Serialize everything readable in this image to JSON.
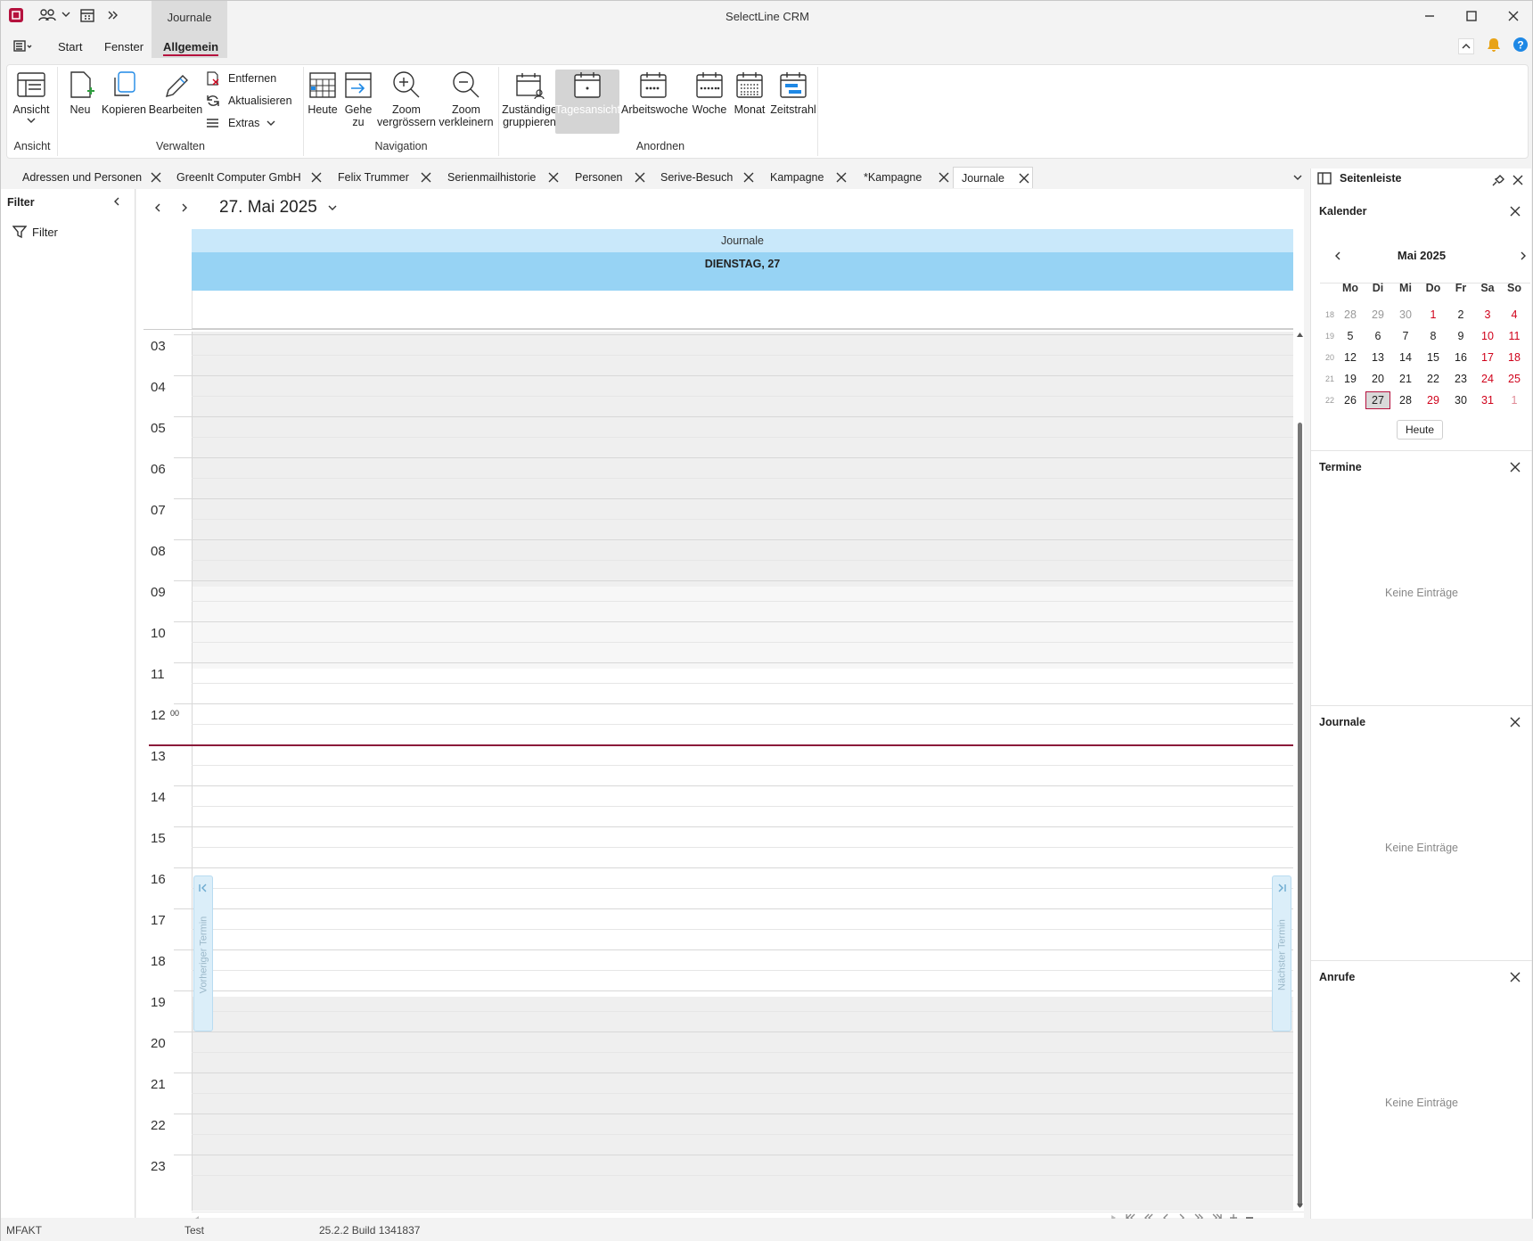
{
  "app": {
    "title": "SelectLine CRM",
    "context_tab": "Journale"
  },
  "menu": {
    "items": [
      "Start",
      "Fenster",
      "Allgemein"
    ],
    "active": "Allgemein"
  },
  "ribbon": {
    "ansicht": {
      "button": "Ansicht",
      "group": "Ansicht"
    },
    "verwalten": {
      "neu": "Neu",
      "kopieren": "Kopieren",
      "bearbeiten": "Bearbeiten",
      "entfernen": "Entfernen",
      "aktualisieren": "Aktualisieren",
      "extras": "Extras",
      "group": "Verwalten"
    },
    "navigation": {
      "heute": "Heute",
      "gehe_zu_1": "Gehe",
      "gehe_zu_2": "zu",
      "zoom_in_1": "Zoom",
      "zoom_in_2": "vergrössern",
      "zoom_out_1": "Zoom",
      "zoom_out_2": "verkleinern",
      "group": "Navigation"
    },
    "anordnen": {
      "zustaendige_1": "Zuständige",
      "zustaendige_2": "gruppieren",
      "tagesansicht": "Tagesansicht",
      "arbeitswoche": "Arbeitswoche",
      "woche": "Woche",
      "monat": "Monat",
      "zeitstrahl": "Zeitstrahl",
      "group": "Anordnen"
    }
  },
  "doc_tabs": [
    "Adressen und Personen",
    "GreenIt Computer GmbH",
    "Felix Trummer",
    "Serienmailhistorie",
    "Personen",
    "Serive-Besuch",
    "Kampagne",
    "*Kampagne",
    "Journale"
  ],
  "filter_panel": {
    "title": "Filter",
    "item": "Filter"
  },
  "calendar": {
    "date": "27. Mai 2025",
    "resource": "Journale",
    "day_header": "DIENSTAG, 27",
    "hours": [
      "03",
      "04",
      "05",
      "06",
      "07",
      "08",
      "09",
      "10",
      "11",
      "12",
      "13",
      "14",
      "15",
      "16",
      "17",
      "18",
      "19",
      "20",
      "21",
      "22",
      "23"
    ],
    "minute_label": "00",
    "prev_appointment": "Vorheriger Termin",
    "next_appointment": "Nächster Termin"
  },
  "sidebar": {
    "title": "Seitenleiste",
    "kalender": {
      "title": "Kalender",
      "month": "Mai 2025",
      "weekdays": [
        "Mo",
        "Di",
        "Mi",
        "Do",
        "Fr",
        "Sa",
        "So"
      ],
      "weeks": [
        {
          "wk": "18",
          "days": [
            "28",
            "29",
            "30",
            "1",
            "2",
            "3",
            "4"
          ]
        },
        {
          "wk": "19",
          "days": [
            "5",
            "6",
            "7",
            "8",
            "9",
            "10",
            "11"
          ]
        },
        {
          "wk": "20",
          "days": [
            "12",
            "13",
            "14",
            "15",
            "16",
            "17",
            "18"
          ]
        },
        {
          "wk": "21",
          "days": [
            "19",
            "20",
            "21",
            "22",
            "23",
            "24",
            "25"
          ]
        },
        {
          "wk": "22",
          "days": [
            "26",
            "27",
            "28",
            "29",
            "30",
            "31",
            "1"
          ]
        }
      ],
      "selected": "27",
      "today_button": "Heute"
    },
    "termine": {
      "title": "Termine",
      "empty": "Keine Einträge"
    },
    "journale": {
      "title": "Journale",
      "empty": "Keine Einträge"
    },
    "anrufe": {
      "title": "Anrufe",
      "empty": "Keine Einträge"
    }
  },
  "status": {
    "left": "MFAKT",
    "middle": "Test",
    "build": "25.2.2 Build 1341837"
  },
  "colors": {
    "accent": "#b5123e",
    "day_header": "#97d3f4",
    "resource_header": "#c9e8fa",
    "now_line": "#8b1a3a",
    "holiday": "#d0021b"
  }
}
